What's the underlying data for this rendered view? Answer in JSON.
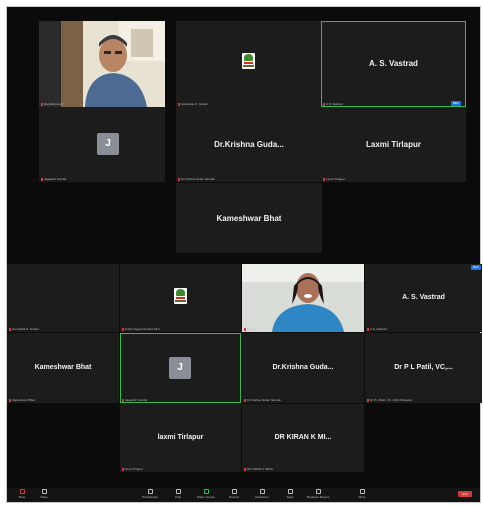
{
  "top_meeting": {
    "tiles": [
      {
        "id": "t1",
        "name": "",
        "label": "Raj Manjunath"
      },
      {
        "id": "t2",
        "name": "",
        "label": "Gurudatta K. Guduri"
      },
      {
        "id": "t3",
        "name": "A. S. Vastrad",
        "label": "A.S. Vastrad"
      },
      {
        "id": "t4",
        "name": "",
        "label": "Jagadish Sundar",
        "avatar": "J"
      },
      {
        "id": "t5",
        "name": "Dr.Krishna  Guda...",
        "label": "Dr.Krishna Guda Yarnelle"
      },
      {
        "id": "t6",
        "name": "Laxmi Tirlapur",
        "label": "Laxmi Tirlapur"
      },
      {
        "id": "t7",
        "name": "Kameshwar Bhat",
        "label": ""
      }
    ],
    "badge": "REC"
  },
  "bottom_meeting": {
    "tiles": [
      {
        "id": "b1",
        "name": "",
        "label": "Gurudatta K. Guduri"
      },
      {
        "id": "b2",
        "name": "",
        "label": "Krishi Vigyan Kendra Sirsi"
      },
      {
        "id": "b3",
        "name": "",
        "label": "Laxmi"
      },
      {
        "id": "b4",
        "name": "A. S. Vastrad",
        "label": "A.S. Vastrad"
      },
      {
        "id": "b5",
        "name": "Kameshwar Bhat",
        "label": "Kameshwar Bhat"
      },
      {
        "id": "b6",
        "name": "",
        "label": "Jagadish Sundar",
        "avatar": "J"
      },
      {
        "id": "b7",
        "name": "Dr.Krishna  Guda...",
        "label": "Dr.Krishna Guda Yarnelle"
      },
      {
        "id": "b8",
        "name": "Dr P L Patil, VC,...",
        "label": "Dr P L Patil, VC, UAS Dharwad"
      },
      {
        "id": "b9",
        "name": "laxmi Tirlapur",
        "label": "laxmi Tirlapur"
      },
      {
        "id": "b10",
        "name": "DR KIRAN K MI...",
        "label": "DR KIRAN K MIRJI"
      }
    ],
    "badge": "REC"
  },
  "toolbar": {
    "items": [
      "Mute",
      "Video",
      "Participants",
      "Chat",
      "Share Screen",
      "Record",
      "Reactions",
      "Apps",
      "Breakout Rooms",
      "More"
    ],
    "end_label": "End"
  },
  "colors": {
    "active_border": "#2fbf50",
    "end_button": "#d23b3b",
    "badge": "#1a73e8"
  }
}
